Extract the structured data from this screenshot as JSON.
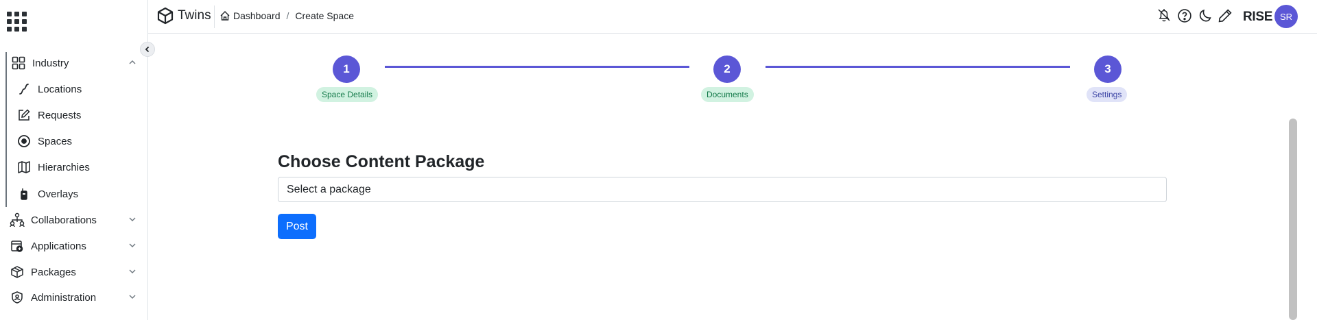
{
  "header": {
    "brand": "Twins",
    "breadcrumb": [
      "Dashboard",
      "Create Space"
    ],
    "breadcrumb_sep": "/",
    "org": "RISE",
    "avatar_initials": "SR"
  },
  "sidebar": {
    "items": [
      {
        "label": "Industry",
        "icon": "grid-icon"
      },
      {
        "label": "Locations",
        "icon": "route-icon"
      },
      {
        "label": "Requests",
        "icon": "edit-icon"
      },
      {
        "label": "Spaces",
        "icon": "target-icon"
      },
      {
        "label": "Hierarchies",
        "icon": "map-icon"
      },
      {
        "label": "Overlays",
        "icon": "walkie-talkie-icon"
      },
      {
        "label": "Collaborations",
        "icon": "network-icon"
      },
      {
        "label": "Applications",
        "icon": "apps-box-icon"
      },
      {
        "label": "Packages",
        "icon": "box-icon"
      },
      {
        "label": "Administration",
        "icon": "shield-user-icon"
      }
    ]
  },
  "stepper": {
    "steps": [
      {
        "number": "1",
        "label": "Space Details",
        "state": "done"
      },
      {
        "number": "2",
        "label": "Documents",
        "state": "done"
      },
      {
        "number": "3",
        "label": "Settings",
        "state": "current"
      }
    ]
  },
  "form": {
    "title": "Choose Content Package",
    "select_value": "Select a package",
    "submit_label": "Post"
  },
  "colors": {
    "accent": "#5b57d6",
    "primary_button": "#0d6efd",
    "done_badge": "#d1f2e1",
    "current_badge": "#e0e3f8"
  }
}
